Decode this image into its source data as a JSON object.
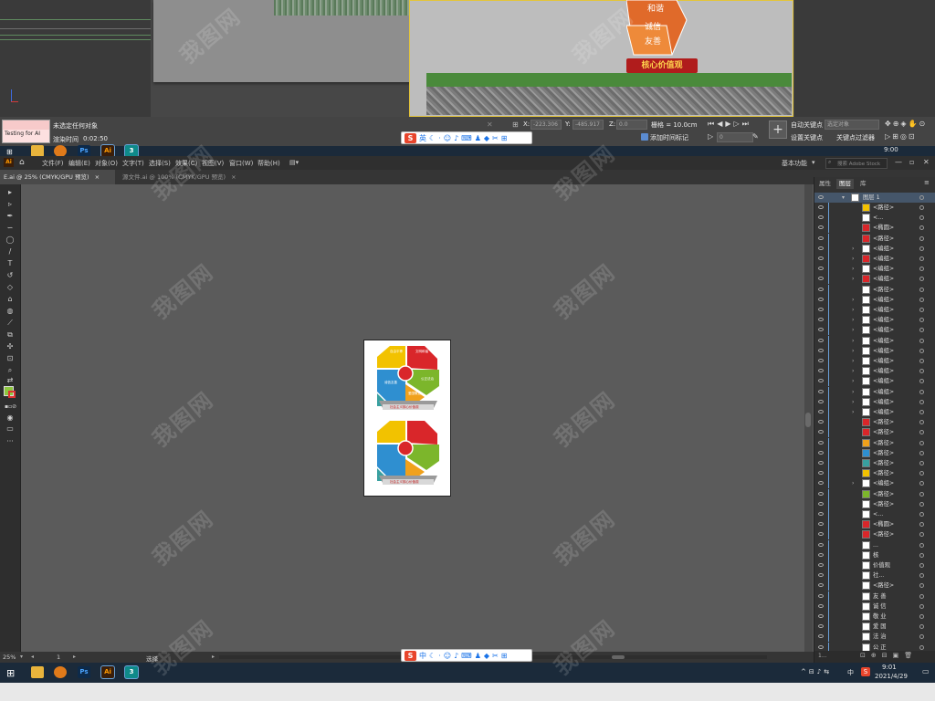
{
  "max_viewport": {
    "sign_texts": [
      "和谐",
      "诚信",
      "友善"
    ],
    "banner_text": "核心价值观"
  },
  "max_status": {
    "script_label": "Testing for AI",
    "selection_status": "未选定任何对象",
    "render_time_label": "渲染时间",
    "render_time_value": "0:02:50",
    "x_label": "X:",
    "x_value": "-223.306",
    "y_label": "Y:",
    "y_value": "-485.917",
    "z_label": "Z:",
    "z_value": "0.0",
    "grid_label": "栅格 = 10.0cm",
    "add_time_tag": "添加时间标记",
    "frame_value": "0",
    "auto_key": "自动关键点",
    "selected_objects": "选定对象",
    "set_key": "设置关键点",
    "key_filter": "关键点过滤器"
  },
  "taskbar_top": {
    "time": "9:00",
    "apps": [
      {
        "name": "file-explorer",
        "label": ""
      },
      {
        "name": "sogou-browser",
        "label": ""
      },
      {
        "name": "photoshop",
        "label": "Ps"
      },
      {
        "name": "illustrator",
        "label": "Ai"
      },
      {
        "name": "3dsmax",
        "label": "3"
      }
    ]
  },
  "ai_menubar": {
    "app_label": "Ai",
    "items": [
      "文件(F)",
      "编辑(E)",
      "对象(O)",
      "文字(T)",
      "选择(S)",
      "效果(C)",
      "视图(V)",
      "窗口(W)",
      "帮助(H)"
    ],
    "workspace": "基本功能",
    "search_placeholder": "搜索 Adobe Stock"
  },
  "ai_tabs": [
    {
      "label": "E.ai @ 25% (CMYK/GPU 预览)",
      "close": "×"
    },
    {
      "label": "源文件.ai @ 100% (CMYK/GPU 预览)",
      "close": "×"
    }
  ],
  "artboard": {
    "panel_labels": [
      "自由平等",
      "文明和谐",
      "公正法治",
      "爱国敬业",
      "诚信友善"
    ],
    "banner": "社会主义核心价值观"
  },
  "ai_status": {
    "zoom": "25%",
    "page": "1",
    "tool": "选择"
  },
  "layers_panel": {
    "tabs": [
      "属性",
      "图层",
      "库"
    ],
    "active_tab": "图层",
    "layer_name": "图层 1",
    "rows": [
      "<路径>",
      "<...",
      "<椭圆>",
      "<路径>",
      "<编组>",
      "<编组>",
      "<编组>",
      "<编组>",
      "<路径>",
      "<编组>",
      "<编组>",
      "<编组>",
      "<编组>",
      "<编组>",
      "<编组>",
      "<编组>",
      "<编组>",
      "<编组>",
      "<编组>",
      "<编组>",
      "<编组>",
      "<路径>",
      "<路径>",
      "<路径>",
      "<路径>",
      "<路径>",
      "<路径>",
      "<编组>",
      "<路径>",
      "<路径>",
      "<...",
      "<椭圆>",
      "<路径>",
      "...",
      "核",
      "价值观",
      "社...",
      "<路径>",
      "友 善",
      "诚 信",
      "敬 业",
      "爱 国",
      "法 治",
      "公 正",
      "平 等"
    ]
  },
  "ime_bar_top": {
    "label": "英"
  },
  "ime_bar_bottom": {
    "label": "中"
  },
  "taskbar_bottom": {
    "time": "9:01",
    "date": "2021/4/29",
    "ime": "中",
    "apps": [
      {
        "name": "file-explorer",
        "label": ""
      },
      {
        "name": "sogou-browser",
        "label": ""
      },
      {
        "name": "photoshop",
        "label": "Ps"
      },
      {
        "name": "illustrator",
        "label": "Ai"
      },
      {
        "name": "3dsmax",
        "label": "3"
      }
    ]
  },
  "watermark": "我图网",
  "colors": {
    "hex_yellow": "#f2c200",
    "hex_red": "#d9262a",
    "hex_green": "#7cb62b",
    "hex_orange": "#f0a11c",
    "hex_blue": "#2f8fd0",
    "hex_teal": "#38a0a0"
  }
}
